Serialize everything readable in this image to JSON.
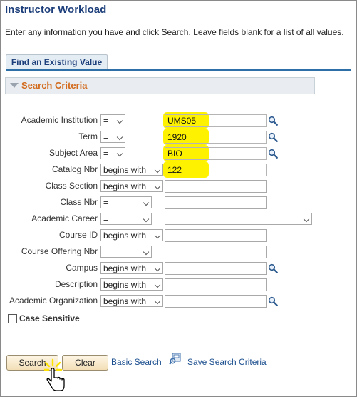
{
  "page": {
    "title": "Instructor Workload",
    "instructions": "Enter any information you have and click Search. Leave fields blank for a list of all values."
  },
  "tab": {
    "label": "Find an Existing Value"
  },
  "section": {
    "label": "Search Criteria"
  },
  "fields": [
    {
      "label": "Academic Institution",
      "operator": "=",
      "value": "UMS05",
      "highlighted": true,
      "lookup": true
    },
    {
      "label": "Term",
      "operator": "=",
      "value": "1920",
      "highlighted": true,
      "lookup": true
    },
    {
      "label": "Subject Area",
      "operator": "=",
      "value": "BIO",
      "highlighted": true,
      "lookup": true
    },
    {
      "label": "Catalog Nbr",
      "operator": "begins with",
      "value": "122",
      "highlighted": true,
      "lookup": false
    },
    {
      "label": "Class Section",
      "operator": "begins with",
      "value": "",
      "highlighted": false,
      "lookup": false
    },
    {
      "label": "Class Nbr",
      "operator": "=",
      "value": "",
      "highlighted": false,
      "lookup": false
    },
    {
      "label": "Academic Career",
      "operator": "=",
      "value": "",
      "highlighted": false,
      "lookup": false
    },
    {
      "label": "Course ID",
      "operator": "begins with",
      "value": "",
      "highlighted": false,
      "lookup": false
    },
    {
      "label": "Course Offering Nbr",
      "operator": "=",
      "value": "",
      "highlighted": false,
      "lookup": false
    },
    {
      "label": "Campus",
      "operator": "begins with",
      "value": "",
      "highlighted": false,
      "lookup": true
    },
    {
      "label": "Description",
      "operator": "begins with",
      "value": "",
      "highlighted": false,
      "lookup": false
    },
    {
      "label": "Academic Organization",
      "operator": "begins with",
      "value": "",
      "highlighted": false,
      "lookup": true
    }
  ],
  "case_sensitive": {
    "label": "Case Sensitive",
    "checked": false
  },
  "buttons": {
    "search": "Search",
    "clear": "Clear"
  },
  "links": {
    "basic_search": "Basic Search",
    "save_search": "Save Search Criteria"
  },
  "colors": {
    "title": "#1c3e7a",
    "section_label": "#d36c1f",
    "highlight": "#fff200",
    "link": "#1c4f8f"
  },
  "icons": {
    "lookup": "magnifier-icon",
    "save_search": "save-search-icon",
    "cursor": "hand-pointer-icon"
  }
}
